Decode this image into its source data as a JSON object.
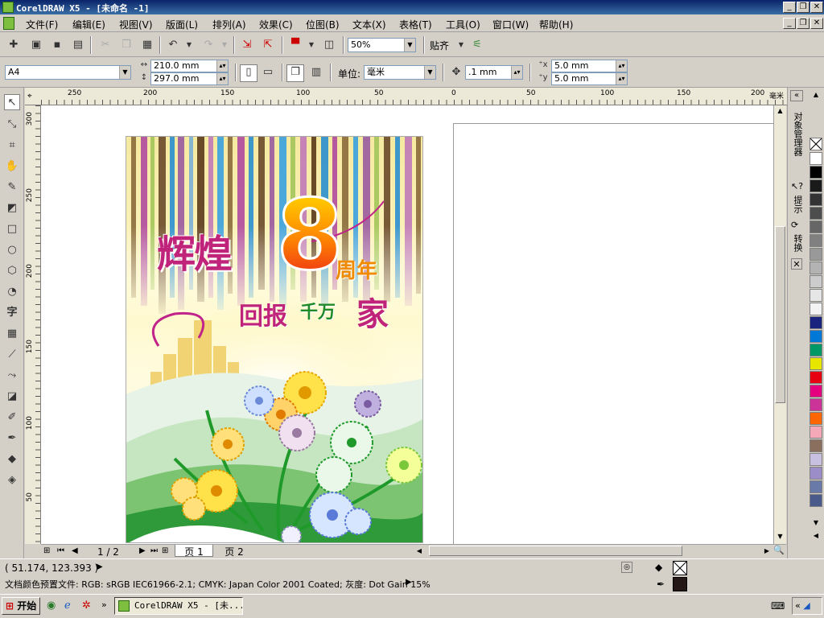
{
  "window": {
    "title": "CorelDRAW X5 - [未命名 -1]"
  },
  "menu": {
    "items": [
      "文件(F)",
      "编辑(E)",
      "视图(V)",
      "版面(L)",
      "排列(A)",
      "效果(C)",
      "位图(B)",
      "文本(X)",
      "表格(T)",
      "工具(O)",
      "窗口(W)",
      "帮助(H)"
    ]
  },
  "toolbar": {
    "zoom_value": "50%",
    "snap_label": "贴齐"
  },
  "propbar": {
    "paper_size": "A4",
    "width": "210.0 mm",
    "height": "297.0 mm",
    "units_label": "单位:",
    "units_value": "毫米",
    "nudge": ".1 mm",
    "dup_x": "5.0 mm",
    "dup_y": "5.0 mm"
  },
  "rulers": {
    "h_ticks": [
      "250",
      "200",
      "150",
      "100",
      "50",
      "0",
      "50",
      "100",
      "150",
      "200",
      "250"
    ],
    "h_unit": "毫米",
    "v_ticks": [
      "300",
      "250",
      "200",
      "150",
      "100",
      "50"
    ]
  },
  "artwork": {
    "title_main": "辉煌",
    "number": "8",
    "anniv": "周年",
    "subtitle_1": "回报",
    "subtitle_2": "千万",
    "subtitle_3": "家"
  },
  "pager": {
    "count": "1 / 2",
    "tabs": [
      "页 1",
      "页 2"
    ]
  },
  "docker": {
    "tabs": [
      "对象管理器",
      "提示",
      "转换"
    ]
  },
  "palette": {
    "colors": [
      "#ffffff",
      "#000000",
      "#1a1a1a",
      "#333333",
      "#4d4d4d",
      "#666666",
      "#808080",
      "#999999",
      "#b3b3b3",
      "#cccccc",
      "#e6e6e6",
      "#f2f2f2",
      "#1a237e",
      "#0078d7",
      "#009966",
      "#e6e600",
      "#e60012",
      "#e4007f",
      "#cc3399",
      "#ff6600",
      "#f5a9b8",
      "#8b6f5e",
      "#c8c0e0",
      "#9b8ec8",
      "#6a7aa8",
      "#4a5a8a"
    ]
  },
  "status": {
    "coords": "( 51.174, 123.393 )",
    "color_profile": "文档颜色预置文件: RGB: sRGB IEC61966-2.1; CMYK: Japan Color 2001 Coated; 灰度: Dot Gain 15%"
  },
  "taskbar": {
    "start": "开始",
    "task": "CorelDRAW X5 - [未..."
  }
}
